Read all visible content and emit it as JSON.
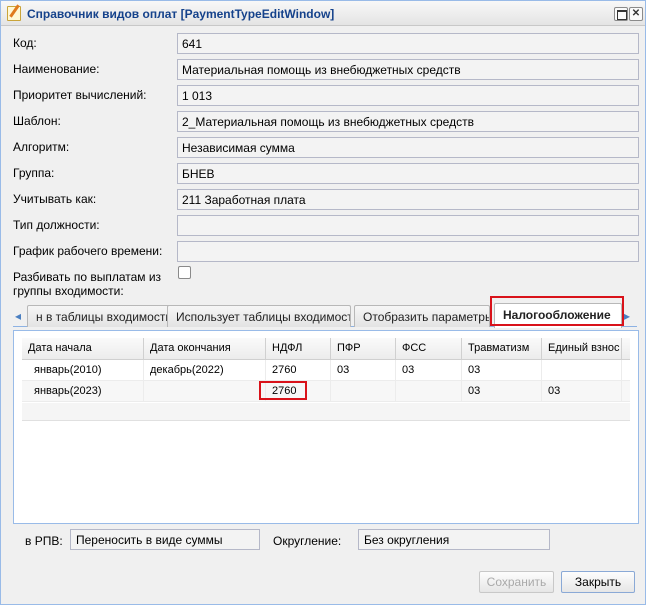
{
  "window": {
    "title": "Справочник видов оплат [PaymentTypeEditWindow]"
  },
  "form": {
    "code": {
      "label": "Код:",
      "value": "641"
    },
    "name": {
      "label": "Наименование:",
      "value": "Материальная помощь из внебюджетных средств"
    },
    "priority": {
      "label": "Приоритет вычислений:",
      "value": "1 013"
    },
    "template": {
      "label": "Шаблон:",
      "value": "2_Материальная помощь из внебюджетных средств"
    },
    "algorithm": {
      "label": "Алгоритм:",
      "value": "Независимая сумма"
    },
    "group": {
      "label": "Группа:",
      "value": "БНЕВ"
    },
    "account_as": {
      "label": "Учитывать как:",
      "value": "211 Заработная плата"
    },
    "position_type": {
      "label": "Тип должности:",
      "value": ""
    },
    "schedule": {
      "label": "График рабочего времени:",
      "value": ""
    },
    "split": {
      "label_line1": "Разбивать по выплатам из",
      "label_line2": "группы входимости:"
    }
  },
  "tabs": {
    "items": [
      {
        "label": "н в таблицы входимости"
      },
      {
        "label": "Использует таблицы входимости"
      },
      {
        "label": "Отобразить параметры"
      },
      {
        "label": "Налогообложение"
      }
    ],
    "active_index": 3
  },
  "grid": {
    "columns": [
      "Дата начала",
      "Дата окончания",
      "НДФЛ",
      "ПФР",
      "ФСС",
      "Травматизм",
      "Единый взнос"
    ],
    "rows": [
      [
        "январь(2010)",
        "декабрь(2022)",
        "2760",
        "03",
        "03",
        "03",
        ""
      ],
      [
        "январь(2023)",
        "",
        "2760",
        "",
        "",
        "03",
        "03"
      ]
    ]
  },
  "bottom": {
    "rpv_label": "в РПВ:",
    "rpv_value": "Переносить в виде суммы",
    "rounding_label": "Округление:",
    "rounding_value": "Без округления"
  },
  "buttons": {
    "save": "Сохранить",
    "close": "Закрыть"
  },
  "colors": {
    "highlight": "#d9121a",
    "title_text": "#15428b"
  }
}
